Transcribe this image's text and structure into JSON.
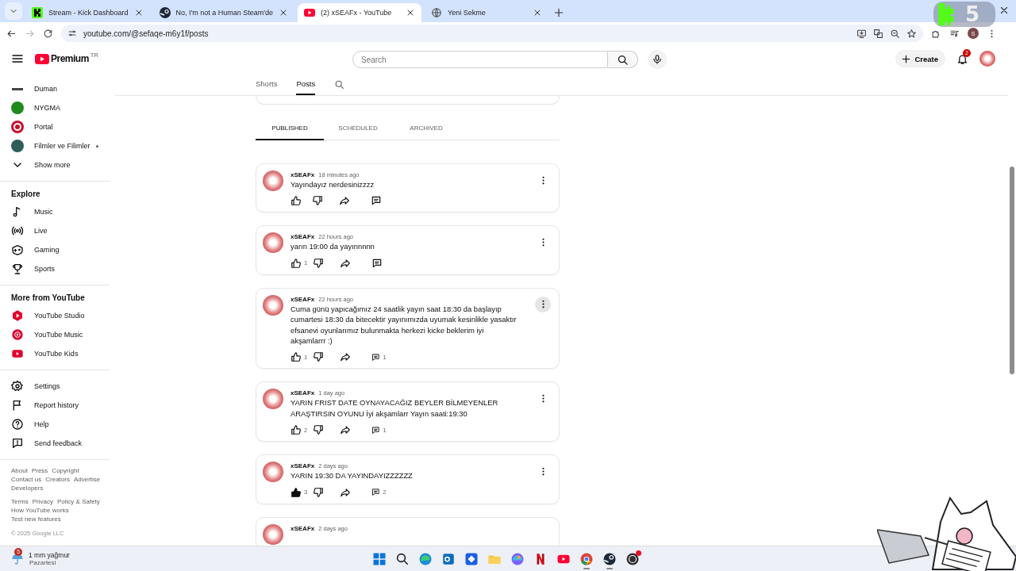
{
  "browser": {
    "tabs": [
      {
        "title": "Stream - Kick Dashboard",
        "kind": "kick",
        "selected": false
      },
      {
        "title": "No, I'm not a Human Steam'de",
        "kind": "steam",
        "selected": false
      },
      {
        "title": "(2) xSEAFx - YouTube",
        "kind": "youtube",
        "selected": true
      },
      {
        "title": "Yeni Sekme",
        "kind": "globe",
        "selected": false
      }
    ],
    "url": "youtube.com/@sefaqe-m6y1f/posts",
    "profile_initial": "S"
  },
  "overlay": {
    "count": "5"
  },
  "masthead": {
    "logo_text": "Premium",
    "region": "TR",
    "search": {
      "placeholder": "Search"
    },
    "create_label": "Create",
    "notifications": "2"
  },
  "sidebar": {
    "subscriptions": [
      {
        "name": "Duman",
        "kind": "wordmark",
        "color": "#444444",
        "new": false
      },
      {
        "name": "NYGMA",
        "kind": "circle",
        "color": "#1e8a1e",
        "new": false
      },
      {
        "name": "Portal",
        "kind": "ring",
        "color": "#c4122f",
        "new": false
      },
      {
        "name": "Filmler ve Filimler",
        "kind": "circle",
        "color": "#2e5e5a",
        "new": true
      }
    ],
    "show_more": "Show more",
    "sections": [
      {
        "title": "Explore",
        "items": [
          {
            "label": "Music",
            "kind": "music"
          },
          {
            "label": "Live",
            "kind": "live"
          },
          {
            "label": "Gaming",
            "kind": "gaming"
          },
          {
            "label": "Sports",
            "kind": "trophy"
          }
        ]
      },
      {
        "title": "More from YouTube",
        "items": [
          {
            "label": "YouTube Studio",
            "kind": "studio"
          },
          {
            "label": "YouTube Music",
            "kind": "ytmusic"
          },
          {
            "label": "YouTube Kids",
            "kind": "kids"
          }
        ]
      },
      {
        "items": [
          {
            "label": "Settings",
            "kind": "gear"
          },
          {
            "label": "Report history",
            "kind": "flag"
          },
          {
            "label": "Help",
            "kind": "help"
          },
          {
            "label": "Send feedback",
            "kind": "feedback"
          }
        ]
      }
    ],
    "footer_links": [
      [
        "About",
        "Press",
        "Copyright",
        "Contact us",
        "Creators",
        "Advertise",
        "Developers"
      ],
      [
        "Terms",
        "Privacy",
        "Policy & Safety",
        "How YouTube works",
        "Test new features"
      ]
    ],
    "copyright": "© 2025 Google LLC"
  },
  "channel_tabs": [
    {
      "label": "Shorts",
      "selected": false
    },
    {
      "label": "Posts",
      "selected": true
    }
  ],
  "post_filters": [
    {
      "label": "PUBLISHED",
      "selected": true
    },
    {
      "label": "SCHEDULED",
      "selected": false
    },
    {
      "label": "ARCHIVED",
      "selected": false
    }
  ],
  "posts": [
    {
      "author": "xSEAFx",
      "time": "18 minutes ago",
      "text": "Yayındayız nerdesinizzzz",
      "liked": false,
      "menu_hovered": false
    },
    {
      "author": "xSEAFx",
      "time": "22 hours ago",
      "text": "yarın 19:00 da yayınnnnn",
      "likes": "1",
      "liked": false,
      "menu_hovered": false
    },
    {
      "author": "xSEAFx",
      "time": "22 hours ago",
      "text": "Cuma günü yapıcağımız 24 saatlik yayın saat 18:30 da başlayıp cumartesi 18:30 da bitecektir yayınımızda uyumak kesinlikle yasaktır efsanevi oyunlarımız bulunmakta herkezi kicke beklerim iyi akşamlarrr :)",
      "likes": "1",
      "comments": "1",
      "liked": false,
      "menu_hovered": true
    },
    {
      "author": "xSEAFx",
      "time": "1 day ago",
      "text": "YARIN FRIST DATE OYNAYACAĞIZ BEYLER BİLMEYENLER ARAŞTIRSIN OYUNU İyi akşamlarr Yayın saati:19:30",
      "likes": "2",
      "comments": "1",
      "liked": false,
      "menu_hovered": false
    },
    {
      "author": "xSEAFx",
      "time": "2 days ago",
      "text": "YARIN 19:30 DA YAYINDAYIZZZZZZ",
      "likes": "3",
      "comments": "2",
      "liked": true,
      "menu_hovered": false
    },
    {
      "author": "xSEAFx",
      "time": "2 days ago"
    }
  ],
  "taskbar": {
    "weather": {
      "badge": "5",
      "condition": "1 mm yağmur",
      "day": "Pazartesi"
    },
    "apps": [
      {
        "kind": "start",
        "running": false,
        "alert": false
      },
      {
        "kind": "search",
        "running": false,
        "alert": false
      },
      {
        "kind": "edge",
        "running": false,
        "alert": false
      },
      {
        "kind": "outlook",
        "running": false,
        "alert": false
      },
      {
        "kind": "bluebox",
        "running": false,
        "alert": false
      },
      {
        "kind": "files",
        "running": false,
        "alert": false
      },
      {
        "kind": "copilot",
        "running": false,
        "alert": false
      },
      {
        "kind": "netflix",
        "running": false,
        "alert": false
      },
      {
        "kind": "youtube",
        "running": false,
        "alert": false
      },
      {
        "kind": "chrome",
        "running": true,
        "alert": false
      },
      {
        "kind": "steam",
        "running": true,
        "alert": false
      },
      {
        "kind": "obs",
        "running": false,
        "alert": true
      }
    ]
  }
}
